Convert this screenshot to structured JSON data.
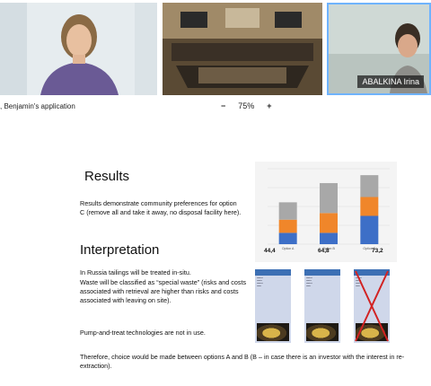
{
  "video": {
    "tiles": [
      {
        "kind": "participant"
      },
      {
        "kind": "conference-room"
      },
      {
        "kind": "participant",
        "name": "ABALKINA Irina"
      }
    ]
  },
  "toolbar": {
    "app_name": ", Benjamin's application",
    "zoom_out": "−",
    "zoom_level": "75%",
    "zoom_in": "+"
  },
  "slide": {
    "heading_results": "Results",
    "results_text": "Results demonstrate community preferences for option C (remove all and take it away, no disposal facility here).",
    "heading_interpretation": "Interpretation",
    "para1": "In Russia tailings will be treated in-situ.",
    "para2": "Waste will be classified as “special waste” (risks and costs associated with retrieval are higher than risks and costs associated with leaving on site).",
    "para3": "Pump-and-treat technologies are not in use.",
    "para4": "Therefore, choice would be made between options A and B (B – in case there is an investor with the interest in re-extraction)."
  },
  "chart_data": {
    "type": "bar",
    "stacked": true,
    "categories": [
      "Option A",
      "Option B",
      "Option C"
    ],
    "totals": [
      44.4,
      64.8,
      73.2
    ],
    "series": [
      {
        "values": [
          12,
          12,
          30
        ],
        "color": "#3d6fc7"
      },
      {
        "values": [
          14,
          21,
          20
        ],
        "color": "#f0862a"
      },
      {
        "values": [
          18.4,
          31.8,
          23.2
        ],
        "color": "#a8a8a8"
      }
    ],
    "ylim": [
      0,
      80
    ],
    "grid": true
  },
  "colors": {
    "accent_blue": "#3c6fb4",
    "selected_border": "#6fb3ff",
    "cross_red": "#d22222"
  },
  "options_panels": [
    {
      "crossed": false
    },
    {
      "crossed": false
    },
    {
      "crossed": true
    }
  ]
}
